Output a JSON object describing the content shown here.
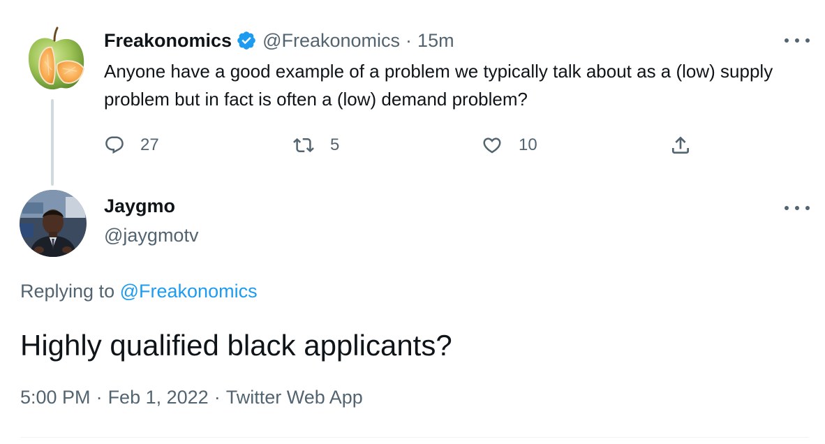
{
  "parent_tweet": {
    "author_name": "Freakonomics",
    "handle": "@Freakonomics",
    "separator": "·",
    "time_ago": "15m",
    "text": "Anyone have a good example of a problem we typically talk about as a (low) supply problem but in fact is often a (low) demand problem?",
    "reply_count": "27",
    "retweet_count": "5",
    "like_count": "10",
    "icons": [
      "verified-badge-icon",
      "reply-icon",
      "retweet-icon",
      "like-icon",
      "share-icon",
      "more-icon"
    ]
  },
  "reply_tweet": {
    "author_name": "Jaygmo",
    "handle": "@jaygmotv",
    "replying_prefix": "Replying to",
    "replying_to": "@Freakonomics",
    "text": "Highly qualified black applicants?",
    "time": "5:00 PM",
    "separator": "·",
    "date": "Feb 1, 2022",
    "source": "Twitter Web App"
  },
  "colors": {
    "text_primary": "#0f1419",
    "text_secondary": "#536471",
    "link": "#1d9bf0",
    "thread_line": "#cfd9de"
  }
}
